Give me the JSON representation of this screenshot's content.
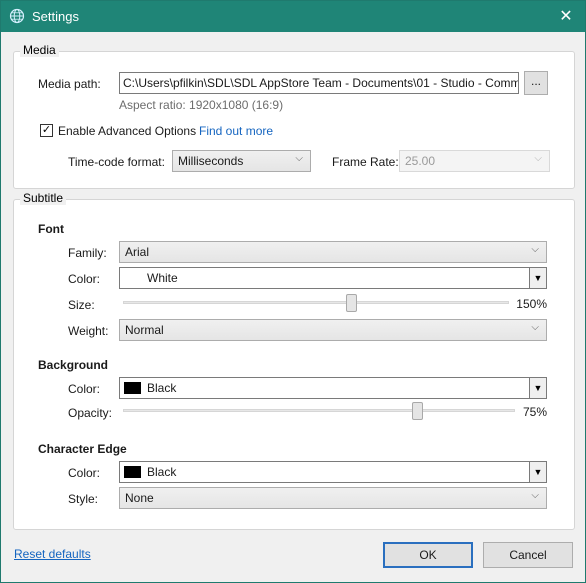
{
  "window": {
    "title": "Settings",
    "close_glyph": "✕",
    "icon": "globe-icon"
  },
  "media": {
    "header": "Media",
    "path_label": "Media path:",
    "path_value": "C:\\Users\\pfilkin\\SDL\\SDL AppStore Team - Documents\\01 - Studio - Comm",
    "browse_label": "...",
    "aspect_ratio": "Aspect ratio:  1920x1080 (16:9)",
    "advanced_checked": true,
    "advanced_label": "Enable Advanced Options",
    "find_out_more": "Find out more",
    "timecode_label": "Time-code format:",
    "timecode_value": "Milliseconds",
    "framerate_label": "Frame Rate:",
    "framerate_value": "25.00"
  },
  "subtitle": {
    "header": "Subtitle",
    "font": {
      "title": "Font",
      "family_label": "Family:",
      "family_value": "Arial",
      "color_label": "Color:",
      "color_value": "White",
      "color_hex": "#ffffff",
      "size_label": "Size:",
      "size_display": "150%",
      "size_fraction": 0.59,
      "weight_label": "Weight:",
      "weight_value": "Normal"
    },
    "background": {
      "title": "Background",
      "color_label": "Color:",
      "color_value": "Black",
      "color_hex": "#000000",
      "opacity_label": "Opacity:",
      "opacity_display": "75%",
      "opacity_fraction": 0.75
    },
    "edge": {
      "title": "Character Edge",
      "color_label": "Color:",
      "color_value": "Black",
      "color_hex": "#000000",
      "style_label": "Style:",
      "style_value": "None"
    }
  },
  "footer": {
    "reset_label": "Reset defaults",
    "ok_label": "OK",
    "cancel_label": "Cancel"
  },
  "colors": {
    "titlebar": "#1f8577",
    "link": "#1565c0",
    "default_button_border": "#2a6fbf"
  }
}
